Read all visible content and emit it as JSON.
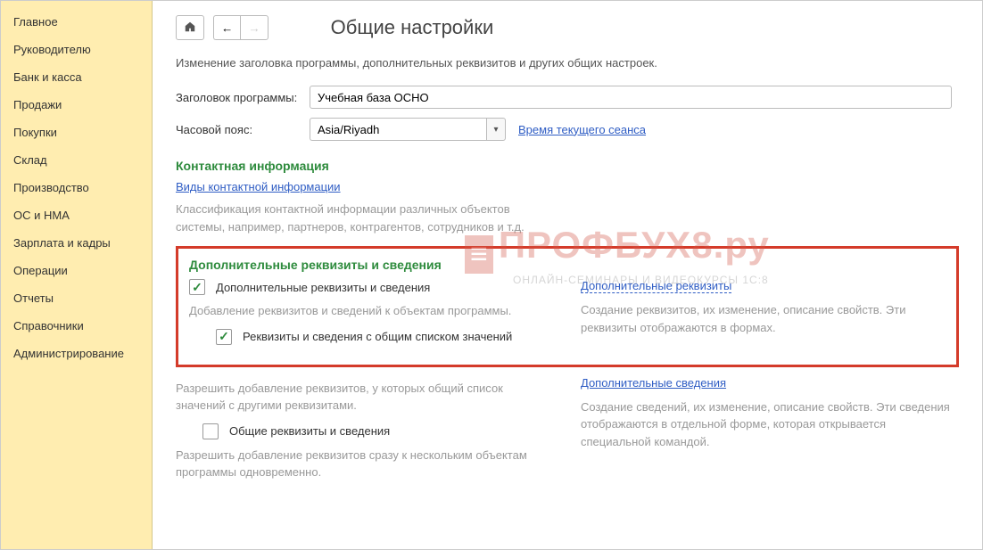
{
  "sidebar": {
    "items": [
      {
        "label": "Главное"
      },
      {
        "label": "Руководителю"
      },
      {
        "label": "Банк и касса"
      },
      {
        "label": "Продажи"
      },
      {
        "label": "Покупки"
      },
      {
        "label": "Склад"
      },
      {
        "label": "Производство"
      },
      {
        "label": "ОС и НМА"
      },
      {
        "label": "Зарплата и кадры"
      },
      {
        "label": "Операции"
      },
      {
        "label": "Отчеты"
      },
      {
        "label": "Справочники"
      },
      {
        "label": "Администрирование"
      }
    ]
  },
  "header": {
    "title": "Общие настройки"
  },
  "description": "Изменение заголовка программы, дополнительных реквизитов и других общих настроек.",
  "form": {
    "title_label": "Заголовок программы:",
    "title_value": "Учебная база ОСНО",
    "tz_label": "Часовой пояс:",
    "tz_value": "Asia/Riyadh",
    "session_time_link": "Время текущего сеанса"
  },
  "contact": {
    "section": "Контактная информация",
    "link": "Виды контактной информации",
    "desc": "Классификация контактной информации различных объектов системы, например, партнеров, контрагентов, сотрудников и т.д."
  },
  "extra": {
    "section": "Дополнительные реквизиты и сведения",
    "cb1_label": "Дополнительные реквизиты и сведения",
    "cb1_desc": "Добавление реквизитов и сведений к объектам программы.",
    "cb2_label": "Реквизиты и сведения с общим списком значений",
    "cb2_desc": "Разрешить добавление реквизитов, у которых общий список значений с другими реквизитами.",
    "cb3_label": "Общие реквизиты и сведения",
    "cb3_desc": "Разрешить добавление реквизитов сразу к нескольким объектам программы одновременно.",
    "link1": "Дополнительные реквизиты",
    "link1_desc": "Создание реквизитов, их изменение, описание свойств. Эти реквизиты отображаются в формах.",
    "link2": "Дополнительные сведения",
    "link2_desc": "Создание сведений, их изменение, описание свойств. Эти сведения отображаются в отдельной форме, которая открывается специальной командой."
  },
  "watermark": {
    "brand": "ПРОФБУХ8",
    "tld": ".ру",
    "sub": "ОНЛАЙН-СЕМИНАРЫ И ВИДЕОКУРСЫ 1С:8"
  }
}
